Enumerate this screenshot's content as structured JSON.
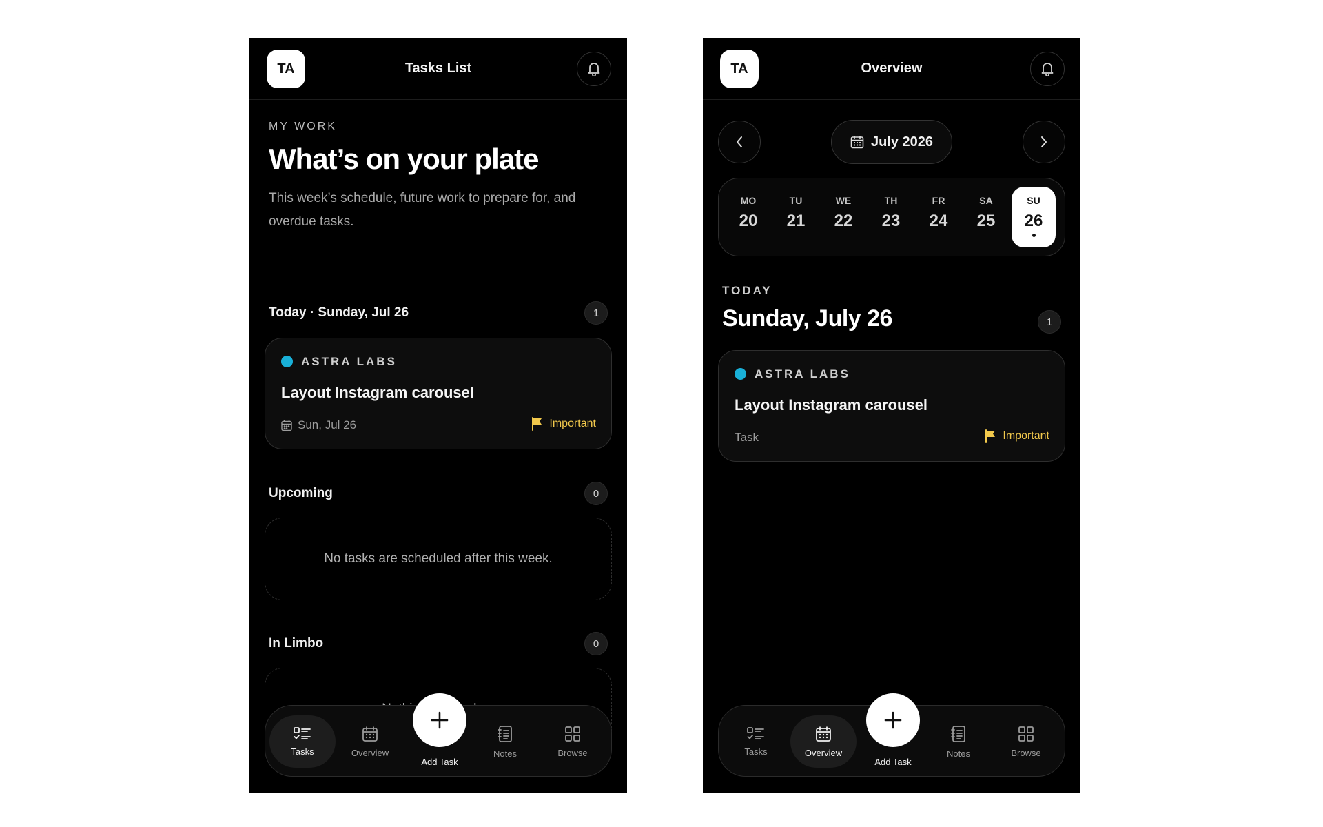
{
  "left": {
    "avatar": "TA",
    "header_title": "Tasks List",
    "eyebrow": "MY WORK",
    "title": "What’s on your plate",
    "description": "This week’s schedule, future work to prepare for, and overdue tasks.",
    "today_section": {
      "title": "Today · Sunday, Jul 26",
      "count": "1"
    },
    "task": {
      "project": "ASTRA LABS",
      "title": "Layout Instagram carousel",
      "date": "Sun, Jul 26",
      "priority": "Important"
    },
    "upcoming_section": {
      "title": "Upcoming",
      "count": "0",
      "empty": "No tasks are scheduled after this week."
    },
    "limbo_section": {
      "title": "In Limbo",
      "count": "0",
      "empty": "Nothing is overdue."
    }
  },
  "right": {
    "avatar": "TA",
    "header_title": "Overview",
    "month": "July 2026",
    "days": [
      {
        "name": "MO",
        "num": "20"
      },
      {
        "name": "TU",
        "num": "21"
      },
      {
        "name": "WE",
        "num": "22"
      },
      {
        "name": "TH",
        "num": "23"
      },
      {
        "name": "FR",
        "num": "24"
      },
      {
        "name": "SA",
        "num": "25"
      },
      {
        "name": "SU",
        "num": "26"
      }
    ],
    "today_eyebrow": "TODAY",
    "today_title": "Sunday, July 26",
    "today_count": "1",
    "task": {
      "project": "ASTRA LABS",
      "title": "Layout Instagram carousel",
      "type": "Task",
      "priority": "Important"
    }
  },
  "nav": {
    "tasks": "Tasks",
    "overview": "Overview",
    "add": "Add Task",
    "notes": "Notes",
    "browse": "Browse"
  },
  "colors": {
    "project_dot": "#19b0d8",
    "important": "#f2c94c",
    "background": "#000000"
  }
}
